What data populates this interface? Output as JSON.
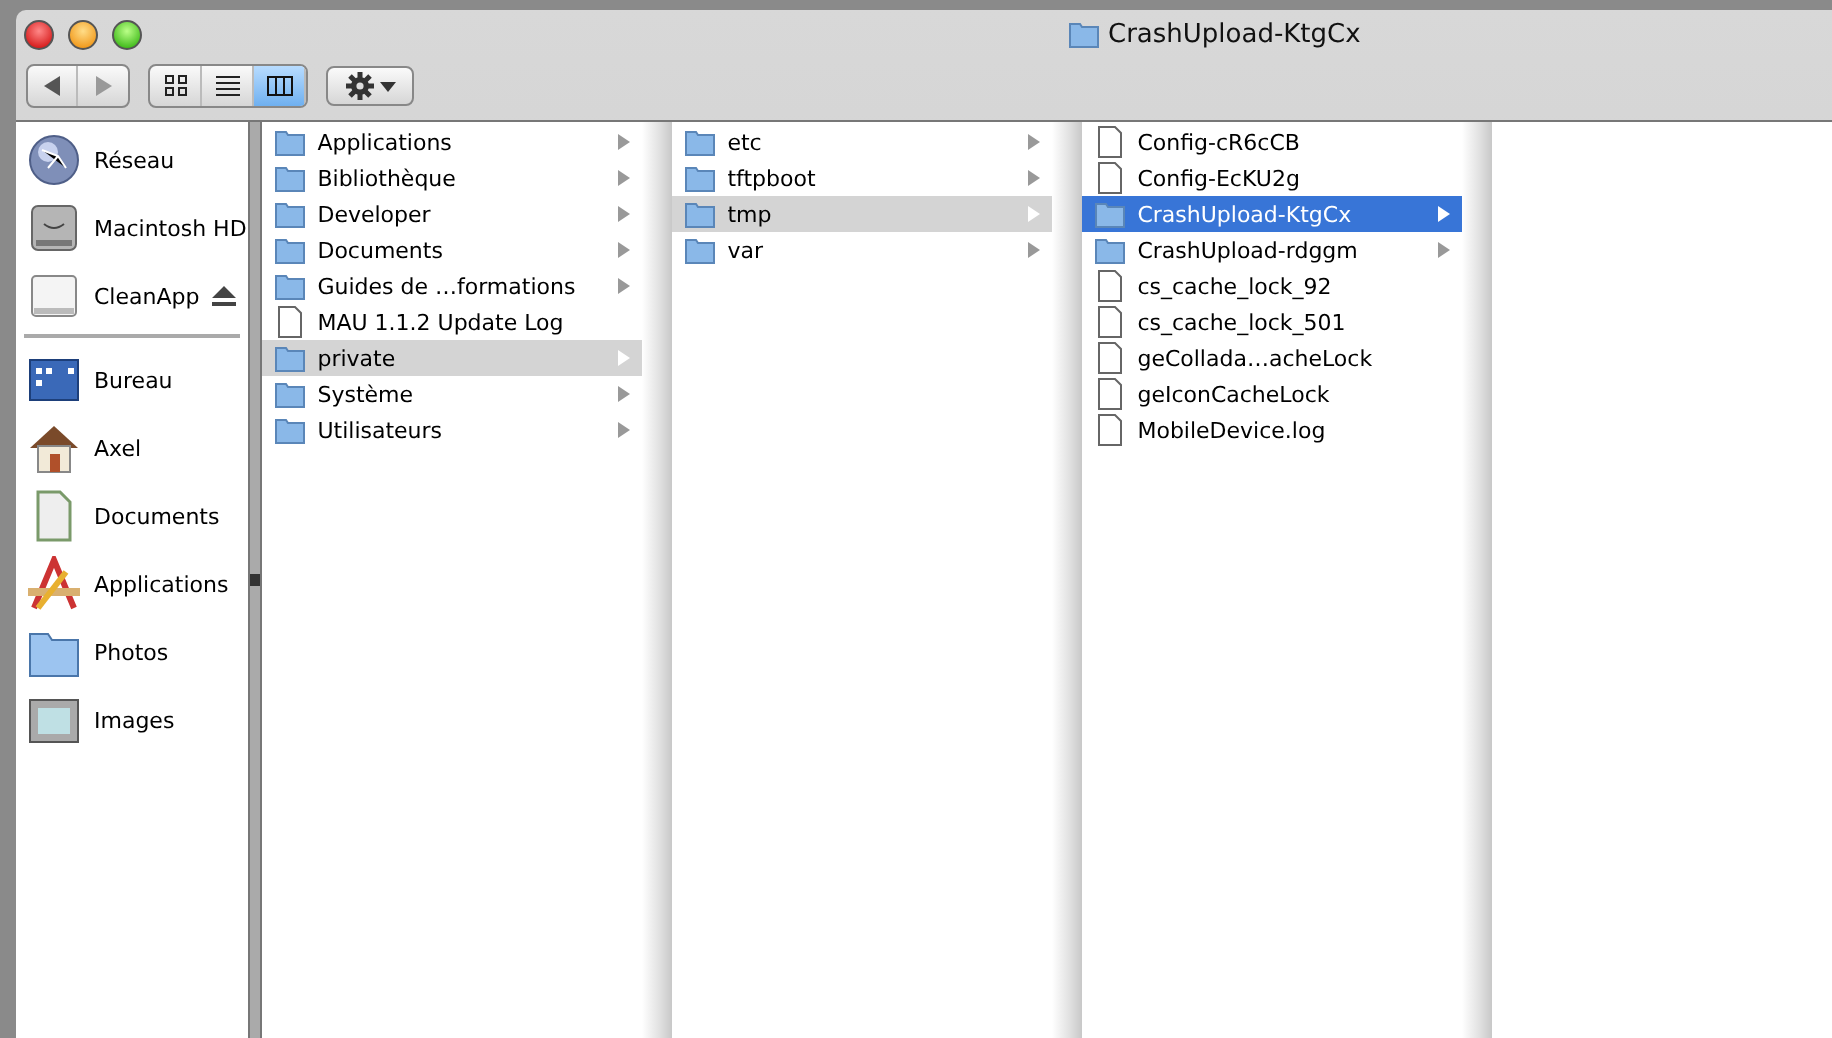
{
  "window": {
    "title": "CrashUpload-KtgCx"
  },
  "toolbar": {
    "views": [
      {
        "kind": "icons",
        "selected": false
      },
      {
        "kind": "list",
        "selected": false
      },
      {
        "kind": "columns",
        "selected": true
      }
    ]
  },
  "sidebar": {
    "devices": [
      {
        "label": "Réseau",
        "kind": "network",
        "ejectable": false
      },
      {
        "label": "Macintosh HD",
        "kind": "disk",
        "ejectable": false
      },
      {
        "label": "CleanApp",
        "kind": "drive",
        "ejectable": true
      }
    ],
    "places": [
      {
        "label": "Bureau",
        "kind": "desktop"
      },
      {
        "label": "Axel",
        "kind": "home"
      },
      {
        "label": "Documents",
        "kind": "documents"
      },
      {
        "label": "Applications",
        "kind": "applications"
      },
      {
        "label": "Photos",
        "kind": "folder"
      },
      {
        "label": "Images",
        "kind": "pictures"
      }
    ]
  },
  "columns": [
    {
      "active": false,
      "items": [
        {
          "name": "Applications",
          "kind": "folder",
          "expandable": true,
          "selected": false
        },
        {
          "name": "Bibliothèque",
          "kind": "folder",
          "expandable": true,
          "selected": false
        },
        {
          "name": "Developer",
          "kind": "folder",
          "expandable": true,
          "selected": false
        },
        {
          "name": "Documents",
          "kind": "folder",
          "expandable": true,
          "selected": false
        },
        {
          "name": "Guides de …formations",
          "kind": "folder",
          "expandable": true,
          "selected": false
        },
        {
          "name": "MAU 1.1.2 Update Log",
          "kind": "file",
          "expandable": false,
          "selected": false
        },
        {
          "name": "private",
          "kind": "folder",
          "expandable": true,
          "selected": true
        },
        {
          "name": "Système",
          "kind": "folder",
          "expandable": true,
          "selected": false
        },
        {
          "name": "Utilisateurs",
          "kind": "folder",
          "expandable": true,
          "selected": false
        }
      ]
    },
    {
      "active": false,
      "items": [
        {
          "name": "etc",
          "kind": "folder",
          "expandable": true,
          "selected": false
        },
        {
          "name": "tftpboot",
          "kind": "folder",
          "expandable": true,
          "selected": false
        },
        {
          "name": "tmp",
          "kind": "folder",
          "expandable": true,
          "selected": true
        },
        {
          "name": "var",
          "kind": "folder",
          "expandable": true,
          "selected": false
        }
      ]
    },
    {
      "active": true,
      "items": [
        {
          "name": "Config-cR6cCB",
          "kind": "file",
          "expandable": false,
          "selected": false
        },
        {
          "name": "Config-EcKU2g",
          "kind": "file",
          "expandable": false,
          "selected": false
        },
        {
          "name": "CrashUpload-KtgCx",
          "kind": "folder",
          "expandable": true,
          "selected": true
        },
        {
          "name": "CrashUpload-rdggm",
          "kind": "folder",
          "expandable": true,
          "selected": false
        },
        {
          "name": "cs_cache_lock_92",
          "kind": "file",
          "expandable": false,
          "selected": false
        },
        {
          "name": "cs_cache_lock_501",
          "kind": "file",
          "expandable": false,
          "selected": false
        },
        {
          "name": "geCollada…acheLock",
          "kind": "file",
          "expandable": false,
          "selected": false
        },
        {
          "name": "geIconCacheLock",
          "kind": "file",
          "expandable": false,
          "selected": false
        },
        {
          "name": "MobileDevice.log",
          "kind": "file",
          "expandable": false,
          "selected": false
        }
      ]
    }
  ]
}
